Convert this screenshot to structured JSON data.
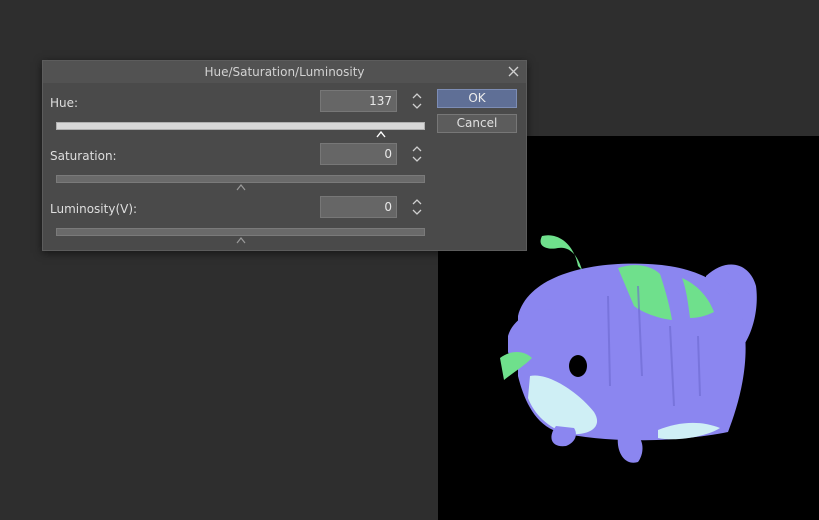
{
  "dialog": {
    "title": "Hue/Saturation/Luminosity",
    "ok_label": "OK",
    "cancel_label": "Cancel"
  },
  "fields": [
    {
      "label": "Hue:",
      "value": "137",
      "min": -180,
      "max": 180,
      "value_num": 137
    },
    {
      "label": "Saturation:",
      "value": "0",
      "min": -100,
      "max": 100,
      "value_num": 0
    },
    {
      "label": "Luminosity(V):",
      "value": "0",
      "min": -100,
      "max": 100,
      "value_num": 0
    }
  ],
  "colors": {
    "canvas_bg": "#000000",
    "character_body": "#8b86f0",
    "character_belly": "#cfeff5",
    "character_accent": "#6fe08c",
    "ok_button": "#5f6f96"
  },
  "icons": {
    "close": "close-icon",
    "spinner": "up-down-arrows-icon",
    "slider_thumb": "caret-up-icon"
  }
}
